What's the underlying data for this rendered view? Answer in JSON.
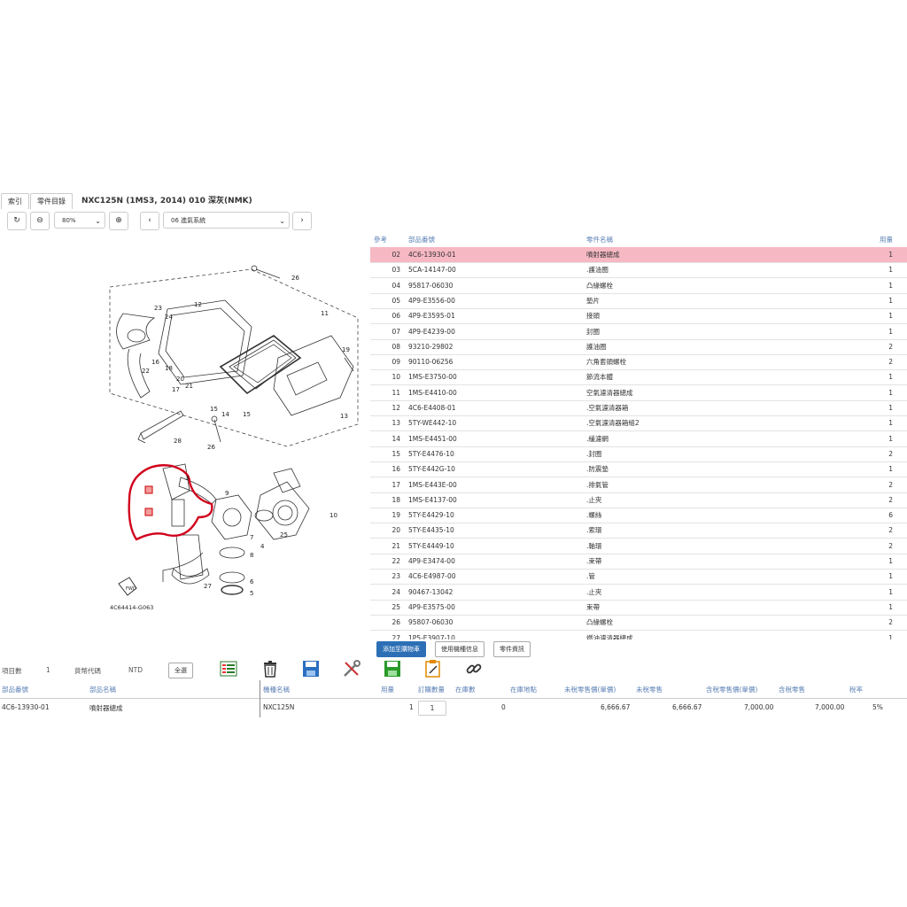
{
  "tabs": [
    "索引",
    "零件目錄"
  ],
  "title": "NXC125N (1MS3, 2014) 010 深灰(NMK)",
  "toolbar": {
    "zoom": "80%",
    "section": "06 進氣系統"
  },
  "diagram": {
    "code": "4C64414-G063",
    "fwd_label": "FWD",
    "callouts": [
      "26",
      "11",
      "12",
      "23",
      "24",
      "19",
      "16",
      "22",
      "18",
      "17",
      "20",
      "21",
      "14",
      "15",
      "15",
      "13",
      "28",
      "25",
      "26",
      "9",
      "3",
      "7",
      "10",
      "25",
      "27",
      "8",
      "6",
      "5",
      "4"
    ]
  },
  "parts_table": {
    "headers": {
      "ref": "參考",
      "part_no": "部品番號",
      "name": "零件名稱",
      "qty": "用量"
    },
    "rows": [
      {
        "ref": "02",
        "part_no": "4C6-13930-01",
        "name": "噴射器總成",
        "qty": "1"
      },
      {
        "ref": "03",
        "part_no": "5CA-14147-00",
        "name": ".護油圈",
        "qty": "1"
      },
      {
        "ref": "04",
        "part_no": "95817-06030",
        "name": "凸緣螺栓",
        "qty": "1"
      },
      {
        "ref": "05",
        "part_no": "4P9-E3556-00",
        "name": "墊片",
        "qty": "1"
      },
      {
        "ref": "06",
        "part_no": "4P9-E3595-01",
        "name": "接頭",
        "qty": "1"
      },
      {
        "ref": "07",
        "part_no": "4P9-E4239-00",
        "name": "封圈",
        "qty": "1"
      },
      {
        "ref": "08",
        "part_no": "93210-29802",
        "name": "護油圈",
        "qty": "2"
      },
      {
        "ref": "09",
        "part_no": "90110-06256",
        "name": "六角套頭螺栓",
        "qty": "2"
      },
      {
        "ref": "10",
        "part_no": "1MS-E3750-00",
        "name": "節流本體",
        "qty": "1"
      },
      {
        "ref": "11",
        "part_no": "1MS-E4410-00",
        "name": "空氣濾清器總成",
        "qty": "1"
      },
      {
        "ref": "12",
        "part_no": "4C6-E4408-01",
        "name": ".空氣濾清器箱",
        "qty": "1"
      },
      {
        "ref": "13",
        "part_no": "5TY-WE442-10",
        "name": ".空氣濾清器箱組2",
        "qty": "1"
      },
      {
        "ref": "14",
        "part_no": "1MS-E4451-00",
        "name": ".緩濾網",
        "qty": "1"
      },
      {
        "ref": "15",
        "part_no": "5TY-E4476-10",
        "name": ".封圈",
        "qty": "2"
      },
      {
        "ref": "16",
        "part_no": "5TY-E442G-10",
        "name": ".防震墊",
        "qty": "1"
      },
      {
        "ref": "17",
        "part_no": "1MS-E443E-00",
        "name": ".排氣管",
        "qty": "2"
      },
      {
        "ref": "18",
        "part_no": "1MS-E4137-00",
        "name": ".止夾",
        "qty": "2"
      },
      {
        "ref": "19",
        "part_no": "5TY-E4429-10",
        "name": ".螺絲",
        "qty": "6"
      },
      {
        "ref": "20",
        "part_no": "5TY-E4435-10",
        "name": ".索環",
        "qty": "2"
      },
      {
        "ref": "21",
        "part_no": "5TY-E4449-10",
        "name": ".軸環",
        "qty": "2"
      },
      {
        "ref": "22",
        "part_no": "4P9-E3474-00",
        "name": ".束帶",
        "qty": "1"
      },
      {
        "ref": "23",
        "part_no": "4C6-E4987-00",
        "name": ".管",
        "qty": "1"
      },
      {
        "ref": "24",
        "part_no": "90467-13042",
        "name": ".止夾",
        "qty": "1"
      },
      {
        "ref": "25",
        "part_no": "4P9-E3575-00",
        "name": "束帶",
        "qty": "1"
      },
      {
        "ref": "26",
        "part_no": "95807-06030",
        "name": "凸緣螺栓",
        "qty": "2"
      },
      {
        "ref": "27",
        "part_no": "1P5-E3907-10",
        "name": "燃油濾清器總成",
        "qty": "1"
      }
    ]
  },
  "actions": {
    "add_cart": "添加至購物車",
    "usage_info": "使用機種信息",
    "part_info": "零件資訊"
  },
  "bottom": {
    "item_count_label": "項目數",
    "item_count": "1",
    "currency_label": "貨幣代碼",
    "currency": "NTD",
    "select_all": "全選",
    "headers": [
      "部品番號",
      "部品名稱",
      "機種名稱",
      "用量",
      "訂購數量",
      "在庫數",
      "在庫地點",
      "未稅零售價(單價)",
      "未稅零售",
      "含稅零售價(單價)",
      "含稅零售",
      "稅率"
    ],
    "row": {
      "part_no": "4C6-13930-01",
      "name": "噴射器總成",
      "model": "NXC125N",
      "qty": "1",
      "order_qty": "1",
      "stock": "0",
      "price_ex": "6,666.67",
      "total_ex": "6,666.67",
      "price_in": "7,000.00",
      "total_in": "7,000.00",
      "tax": "5%"
    }
  },
  "colors": {
    "highlight": "#f6b8c3",
    "accent": "#2c6fb5",
    "link": "#5a7fb5"
  }
}
